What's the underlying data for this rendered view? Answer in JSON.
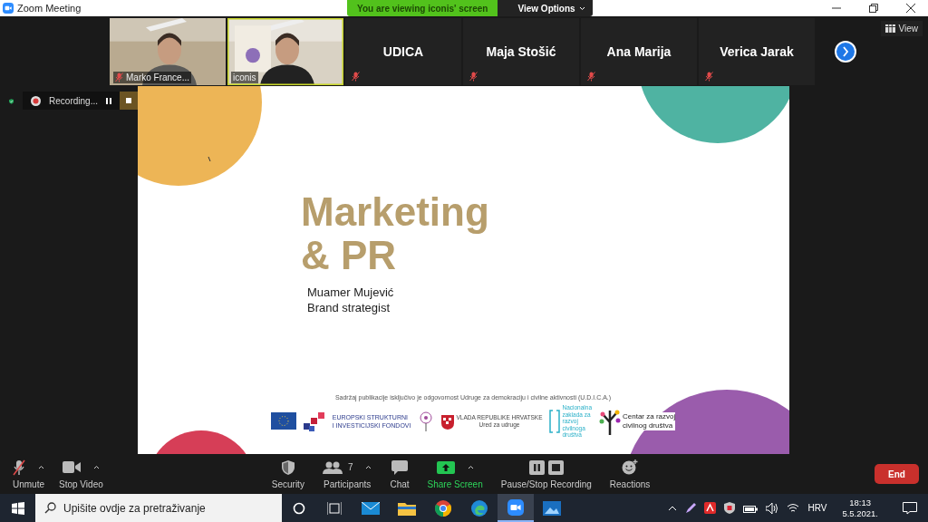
{
  "window": {
    "title": "Zoom Meeting"
  },
  "banner": {
    "text": "You are viewing iconis' screen",
    "options": "View Options"
  },
  "view_button": "View",
  "participants": [
    {
      "kind": "video",
      "name": "Marko France...",
      "muted": true,
      "active": false
    },
    {
      "kind": "video",
      "name": "iconis",
      "muted": false,
      "active": true
    },
    {
      "kind": "name",
      "name": "UDICA",
      "muted": true,
      "active": false
    },
    {
      "kind": "name",
      "name": "Maja Stošić",
      "muted": true,
      "active": false
    },
    {
      "kind": "name",
      "name": "Ana Marija",
      "muted": true,
      "active": false
    },
    {
      "kind": "name",
      "name": "Verica Jarak",
      "muted": true,
      "active": false
    }
  ],
  "recording": {
    "label": "Recording..."
  },
  "slide": {
    "title_lines": [
      "Marketing",
      "& PR"
    ],
    "subtitle_lines": [
      "Muamer Mujević",
      "Brand strategist"
    ],
    "disclaimer": "Sadržaj publikacije isključivo je odgovornost Udruge za demokraciju i civilne aktivnosti (U.D.I.C.A.)",
    "logos": [
      {
        "kind": "eu"
      },
      {
        "kind": "esi",
        "lines": [
          "EUROPSKI STRUKTURNI",
          "I INVESTICIJSKI FONDOVI"
        ]
      },
      {
        "kind": "flower"
      },
      {
        "kind": "crest",
        "lines": [
          "VLADA REPUBLIKE HRVATSKE",
          "Ured za udruge"
        ]
      },
      {
        "kind": "bracket",
        "lines": [
          "Nacionalna",
          "zaklada za",
          "razvoj",
          "civilnoga",
          "društva"
        ]
      },
      {
        "kind": "tree",
        "lines": [
          "Centar za razvoj",
          "civilnog društva"
        ]
      }
    ]
  },
  "toolbar": {
    "left": [
      {
        "kind": "mic",
        "label": "Unmute",
        "caret": true
      },
      {
        "kind": "video",
        "label": "Stop Video",
        "caret": true
      }
    ],
    "center": [
      {
        "kind": "shield",
        "label": "Security",
        "caret": false,
        "highlight": false
      },
      {
        "kind": "people",
        "label": "Participants",
        "count": "7",
        "caret": true,
        "highlight": false
      },
      {
        "kind": "chat",
        "label": "Chat",
        "caret": false,
        "highlight": false
      },
      {
        "kind": "share",
        "label": "Share Screen",
        "caret": true,
        "highlight": true
      },
      {
        "kind": "record",
        "label": "Pause/Stop Recording",
        "caret": false,
        "highlight": false
      },
      {
        "kind": "reaction",
        "label": "Reactions",
        "caret": false,
        "highlight": false
      }
    ],
    "end": "End"
  },
  "taskbar": {
    "search": {
      "placeholder": "Upišite ovdje za pretraživanje"
    },
    "apps": [
      {
        "kind": "mail",
        "active": false
      },
      {
        "kind": "folder",
        "active": false
      },
      {
        "kind": "chrome",
        "active": false
      },
      {
        "kind": "edge",
        "active": false
      },
      {
        "kind": "zoom",
        "active": true
      },
      {
        "kind": "photos",
        "active": false
      }
    ],
    "language": "HRV",
    "time": "18:13",
    "date": "5.5.2021."
  }
}
